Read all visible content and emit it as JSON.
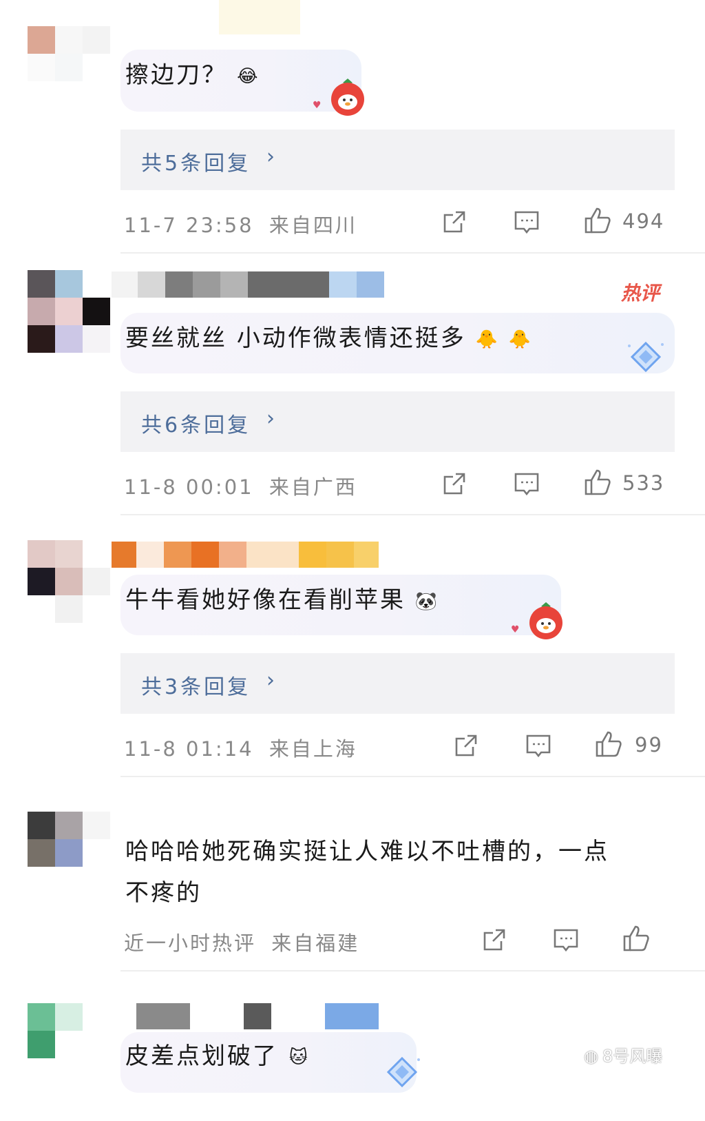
{
  "comments": [
    {
      "text": "擦边刀？",
      "emoji": "😂",
      "replies_label": "共5条回复",
      "chevron": "›",
      "time": "11-7 23:58",
      "location": "来自四川",
      "likes": "494"
    },
    {
      "text": "要丝就丝 小动作微表情还挺多",
      "emoji": "🐥",
      "hot_badge": "热评",
      "replies_label": "共6条回复",
      "chevron": "›",
      "time": "11-8 00:01",
      "location": "来自广西",
      "likes": "533"
    },
    {
      "text": "牛牛看她好像在看削苹果",
      "emoji": "🐼",
      "replies_label": "共3条回复",
      "chevron": "›",
      "time": "11-8 01:14",
      "location": "来自上海",
      "likes": "99"
    },
    {
      "text_line1": "哈哈哈她死确实挺让人难以不吐槽的，一点",
      "text_line2": "不疼的",
      "time": "近一小时热评",
      "location": "来自福建"
    },
    {
      "text": "皮差点划破了",
      "emoji": "🐱"
    }
  ],
  "watermark": "8号风曝",
  "icons": {
    "share": "share-icon",
    "comment": "comment-icon",
    "like": "thumbs-up-icon",
    "mascot": "strawberry-mascot-icon",
    "badge": "diamond-badge-icon"
  },
  "colors": {
    "reply_link": "#4d6d9a",
    "meta_text": "#888888",
    "hot_badge": "#e8574a",
    "reply_box": "#f2f2f4"
  }
}
